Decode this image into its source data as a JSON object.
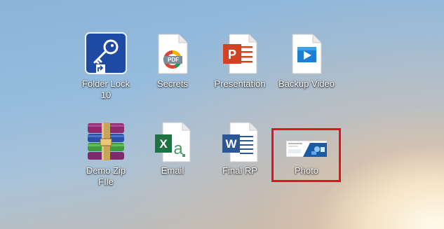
{
  "desktop": {
    "icons": [
      {
        "label": "Folder Lock\n10",
        "icon": "folder-lock-icon"
      },
      {
        "label": "Secrets",
        "icon": "pdf-file-icon"
      },
      {
        "label": "Presentation",
        "icon": "powerpoint-file-icon"
      },
      {
        "label": "Backup Video",
        "icon": "video-file-icon"
      },
      {
        "label": "Demo Zip\nFIle",
        "icon": "winrar-archive-icon"
      },
      {
        "label": "Email",
        "icon": "excel-file-icon"
      },
      {
        "label": "Final RP",
        "icon": "word-file-icon"
      },
      {
        "label": "Photo",
        "icon": "image-thumbnail-icon"
      }
    ],
    "selected": "Photo",
    "pdf_badge": "PDF",
    "colors": {
      "highlight": "#e0141e"
    }
  }
}
